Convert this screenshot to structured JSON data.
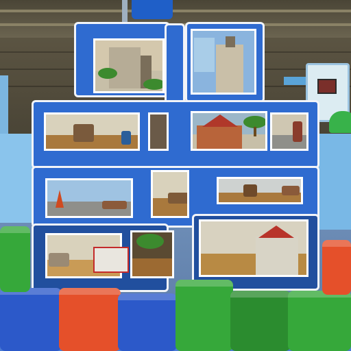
{
  "scene": {
    "colors": {
      "frame_blue": "#2f6bd0",
      "outline_white": "#f2f4f8",
      "block_blue": "#2c59c9",
      "block_orange": "#e5502a",
      "block_green": "#36a83a",
      "floor_blue": "#6f8fb8",
      "wood": "#a9793d"
    },
    "icons": [
      "tree-icon",
      "house-icon",
      "traffic-cone-icon",
      "crate-icon",
      "castle-icon"
    ]
  }
}
